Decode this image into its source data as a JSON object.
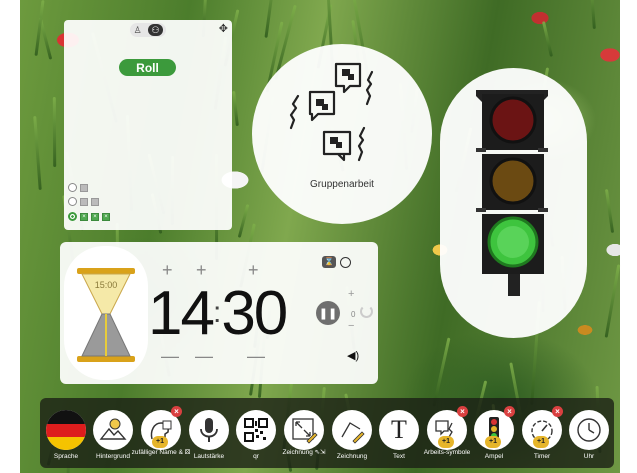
{
  "name_picker": {
    "roll_label": "Roll",
    "mode_icons": [
      "person-icon",
      "group-icon"
    ]
  },
  "group_work": {
    "label": "Gruppenarbeit"
  },
  "traffic_light": {
    "active": "green",
    "colors": {
      "red": "#6b1414",
      "yellow": "#6b4a12",
      "green": "#3ec43e"
    }
  },
  "timer": {
    "minutes": "14",
    "seconds": "30",
    "hourglass_label": "15:00",
    "small_value": "0"
  },
  "toolbar": {
    "items": [
      {
        "label": "Sprache",
        "icon": "germany-flag-icon"
      },
      {
        "label": "Hintergrund",
        "icon": "landscape-icon"
      },
      {
        "label": "zufälliger Name & ⚄",
        "icon": "random-name-icon",
        "badge": "+1"
      },
      {
        "label": "Lautstärke",
        "icon": "microphone-icon"
      },
      {
        "label": "qr",
        "icon": "qr-code-icon"
      },
      {
        "label": "Zeichnung ⇖⇲",
        "icon": "drawing-expand-icon"
      },
      {
        "label": "Zeichnung",
        "icon": "drawing-icon"
      },
      {
        "label": "Text",
        "icon": "text-icon"
      },
      {
        "label": "Arbeits-symbole",
        "icon": "work-symbols-icon",
        "badge": "+1"
      },
      {
        "label": "Ampel",
        "icon": "traffic-light-icon",
        "badge": "+1"
      },
      {
        "label": "Timer",
        "icon": "timer-icon",
        "badge": "+1"
      },
      {
        "label": "Uhr",
        "icon": "clock-icon"
      }
    ]
  },
  "colors": {
    "accent_green": "#3c9a3c",
    "badge_red": "#d94040",
    "badge_yellow": "#e6b52a"
  }
}
